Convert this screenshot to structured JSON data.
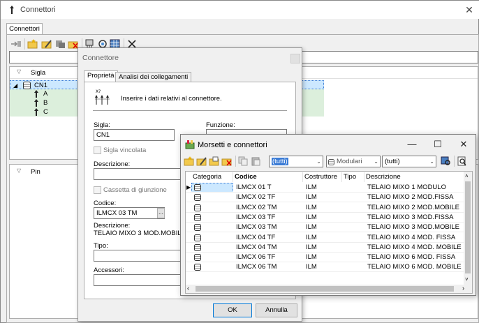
{
  "main": {
    "title": "Connettori",
    "tab": "Connettori",
    "tree_col_sigla": "Sigla",
    "tree_items": [
      "CN1",
      "A",
      "B",
      "C"
    ],
    "pins_col": "Pin"
  },
  "connettore": {
    "title": "Connettore",
    "tabs": [
      "Proprietà",
      "Analisi dei collegamenti"
    ],
    "info_text": "Inserire i dati relativi al connettore.",
    "sigla_label": "Sigla:",
    "sigla_value": "CN1",
    "funzione_label": "Funzione:",
    "sigla_vincolata_label": "Sigla vincolata",
    "descrizione_label": "Descrizione:",
    "cassetta_label": "Cassetta di giunzione",
    "codice_label": "Codice:",
    "codice_value": "ILMCX 03 TM",
    "codice_browse": "...",
    "descrizione2_label": "Descrizione:",
    "descrizione2_value": "TELAIO MIXO 3 MOD.MOBILE",
    "tipo_label": "Tipo:",
    "accessori_label": "Accessori:",
    "ok_label": "OK",
    "cancel_label": "Annulla"
  },
  "morsetti": {
    "title": "Morsetti e connettori",
    "filter1": "(tutti)",
    "filter2": "Modulari",
    "filter3": "(tutti)",
    "columns": [
      "Categoria",
      "Codice",
      "Costruttore",
      "Tipo",
      "Descrizione"
    ],
    "rows": [
      {
        "codice": "ILMCX 01 T",
        "costruttore": "ILM",
        "tipo": "",
        "descrizione": "TELAIO MIXO 1 MODULO"
      },
      {
        "codice": "ILMCX 02 TF",
        "costruttore": "ILM",
        "tipo": "",
        "descrizione": "TELAIO MIXO 2 MOD.FISSA"
      },
      {
        "codice": "ILMCX 02 TM",
        "costruttore": "ILM",
        "tipo": "",
        "descrizione": "TELAIO MIXO 2 MOD.MOBILE"
      },
      {
        "codice": "ILMCX 03 TF",
        "costruttore": "ILM",
        "tipo": "",
        "descrizione": "TELAIO MIXO 3 MOD.FISSA"
      },
      {
        "codice": "ILMCX 03 TM",
        "costruttore": "ILM",
        "tipo": "",
        "descrizione": "TELAIO MIXO 3 MOD.MOBILE"
      },
      {
        "codice": "ILMCX 04 TF",
        "costruttore": "ILM",
        "tipo": "",
        "descrizione": "TELAIO MIXO 4 MOD. FISSA"
      },
      {
        "codice": "ILMCX 04 TM",
        "costruttore": "ILM",
        "tipo": "",
        "descrizione": "TELAIO MIXO 4 MOD. MOBILE"
      },
      {
        "codice": "ILMCX 06 TF",
        "costruttore": "ILM",
        "tipo": "",
        "descrizione": "TELAIO MIXO 6 MOD. FISSA"
      },
      {
        "codice": "ILMCX 06 TM",
        "costruttore": "ILM",
        "tipo": "",
        "descrizione": "TELAIO MIXO 6 MOD. MOBILE"
      }
    ]
  },
  "colors": {
    "selection": "#cce8ff",
    "tree_highlight": "#dcefdc",
    "accent": "#0078d7"
  }
}
